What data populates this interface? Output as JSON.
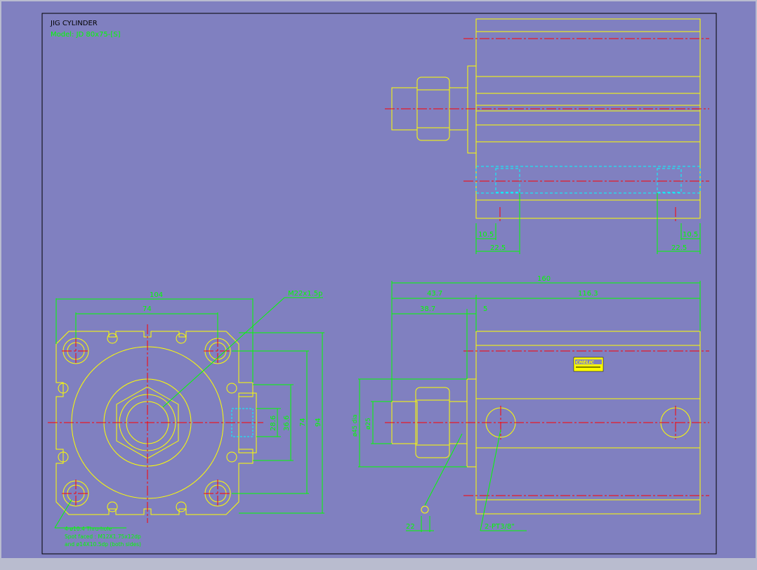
{
  "title": "JIG CYLINDER",
  "model": "Model: JD 80x75-[S]",
  "colors": {
    "background": "#8080c0",
    "outline": "#ffff00",
    "dimension": "#00ff00",
    "centerline": "#ff0000",
    "hidden": "#00ffff",
    "frame": "#000000"
  },
  "dimensions": {
    "front": {
      "width_outer": "104",
      "bolt_pitch": "74",
      "thread": "M22x1.5p",
      "port_h1": "28.6",
      "port_h2": "36.6",
      "pitch_v": "74",
      "height_outer": "94"
    },
    "side": {
      "total": "160",
      "rod_ext": "43.7",
      "body": "116.3",
      "rod_len": "38.7",
      "flange": "5",
      "rod_dia": "ø25",
      "body_dia": "ø45 dia",
      "wrench": "22",
      "port": "2-PT3/8\""
    },
    "top": {
      "left_a": "10.5",
      "left_b": "22.5",
      "right_a": "10.5",
      "right_b": "22.5"
    }
  },
  "notes": [
    "4-ø10.4 Thru-hole ",
    "Spot faced : M12X1.75x12dp",
    "and ø14X10.5dp (both sides)"
  ],
  "brand_label": "CHELIC"
}
